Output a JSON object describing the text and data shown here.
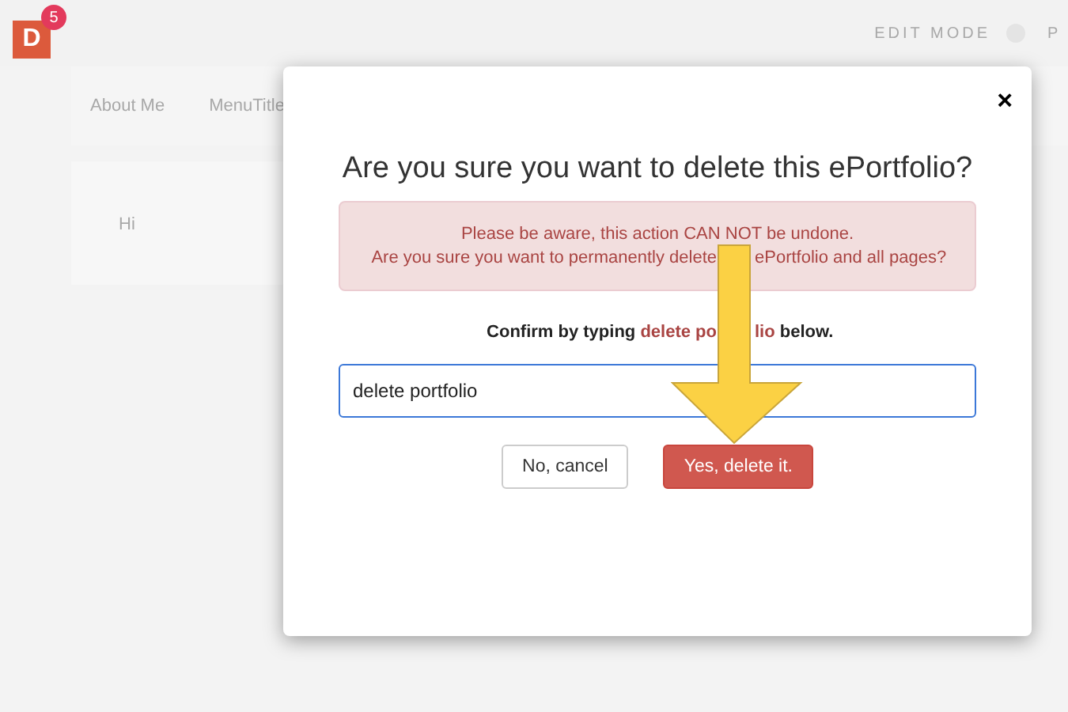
{
  "header": {
    "logo_letter": "D",
    "badge": "5",
    "edit_mode": "EDIT MODE",
    "edit_mode_on": false,
    "cut_label": "P"
  },
  "nav": [
    "About Me",
    "MenuTitle"
  ],
  "page_text": "Hi",
  "dialog": {
    "close": "×",
    "title": "Are you sure you want to delete this ePortfolio?",
    "warning_line_1": "Please be aware, this action CAN NOT be undone.",
    "warning_line_2_start": "Are you sure you want to permanently delete",
    "warning_line_2_end": "ePortfolio and all pages?",
    "confirm_start": "Confirm by typing",
    "confirm_phrase_start": "delete po",
    "confirm_phrase_end": "lio",
    "confirm_end": "below.",
    "input_value": "delete portfolio",
    "buttons": [
      {
        "label": "No, cancel",
        "kind": "default"
      },
      {
        "label": "Yes, delete it.",
        "kind": "danger"
      }
    ]
  }
}
